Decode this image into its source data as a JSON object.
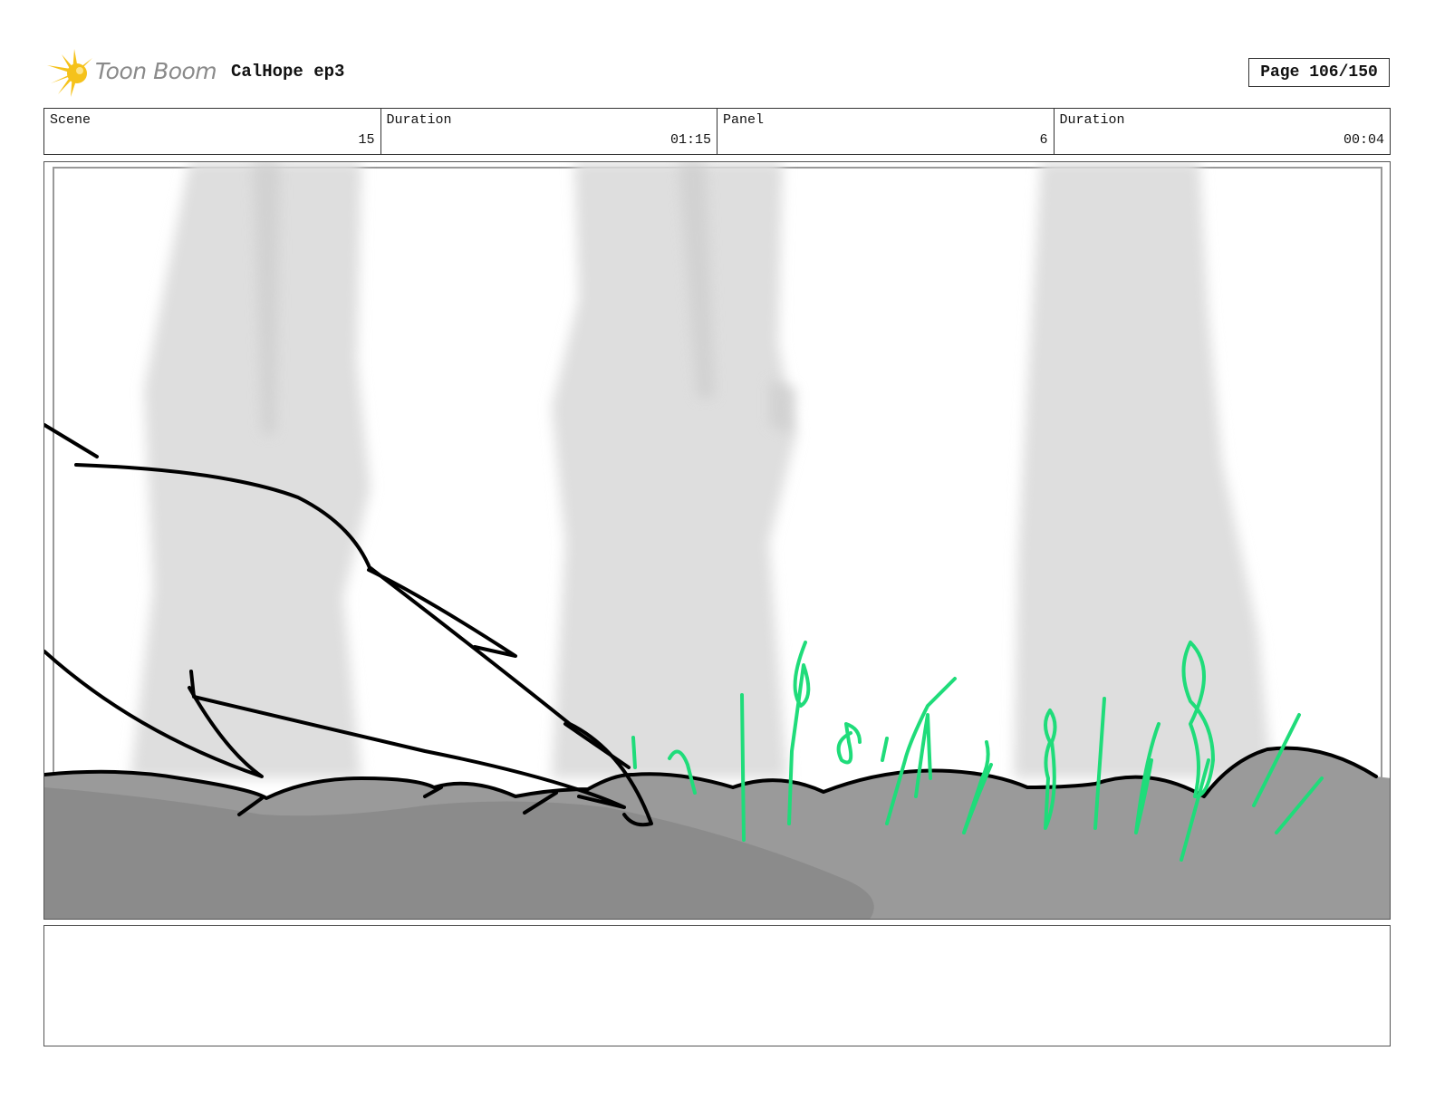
{
  "header": {
    "logo_text": "Toon Boom",
    "project_title": "CalHope ep3",
    "page_label": "Page 106/150"
  },
  "info": {
    "scene_label": "Scene",
    "scene_value": "15",
    "scene_duration_label": "Duration",
    "scene_duration_value": "01:15",
    "panel_label": "Panel",
    "panel_value": "6",
    "panel_duration_label": "Duration",
    "panel_duration_value": "00:04"
  },
  "colors": {
    "logo_yellow": "#f5c21b",
    "grass_green": "#1fdc7a",
    "ground_gray": "#999999",
    "tree_gray": "#dcdcdc"
  },
  "notes": {
    "text": ""
  }
}
